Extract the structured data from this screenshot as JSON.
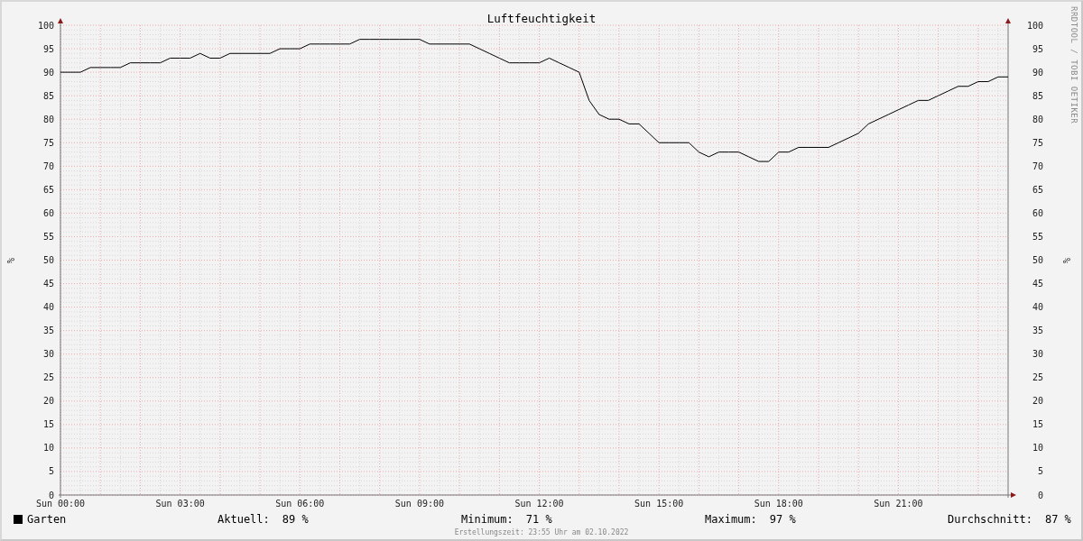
{
  "chart_data": {
    "type": "line",
    "grid": true,
    "title": "Luftfeuchtigkeit",
    "ylabel": "%",
    "ylim": [
      0,
      100
    ],
    "categories": [
      "Sun 00:00",
      null,
      null,
      null,
      null,
      null,
      null,
      null,
      null,
      null,
      null,
      null,
      "Sun 03:00",
      null,
      null,
      null,
      null,
      null,
      null,
      null,
      null,
      null,
      null,
      null,
      "Sun 06:00",
      null,
      null,
      null,
      null,
      null,
      null,
      null,
      null,
      null,
      null,
      null,
      "Sun 09:00",
      null,
      null,
      null,
      null,
      null,
      null,
      null,
      null,
      null,
      null,
      null,
      "Sun 12:00",
      null,
      null,
      null,
      null,
      null,
      null,
      null,
      null,
      null,
      null,
      null,
      "Sun 15:00",
      null,
      null,
      null,
      null,
      null,
      null,
      null,
      null,
      null,
      null,
      null,
      "Sun 18:00",
      null,
      null,
      null,
      null,
      null,
      null,
      null,
      null,
      null,
      null,
      null,
      "Sun 21:00",
      null,
      null,
      null,
      null,
      null,
      null,
      null,
      null,
      null,
      null,
      null
    ],
    "yticks": [
      0,
      5,
      10,
      15,
      20,
      25,
      30,
      35,
      40,
      45,
      50,
      55,
      60,
      65,
      70,
      75,
      80,
      85,
      90,
      95,
      100
    ],
    "series": [
      {
        "name": "Garten",
        "color": "#000000",
        "values": [
          90,
          90,
          90,
          91,
          91,
          91,
          91,
          92,
          92,
          92,
          92,
          93,
          93,
          93,
          94,
          93,
          93,
          94,
          94,
          94,
          94,
          94,
          95,
          95,
          95,
          96,
          96,
          96,
          96,
          96,
          97,
          97,
          97,
          97,
          97,
          97,
          97,
          96,
          96,
          96,
          96,
          96,
          95,
          94,
          93,
          92,
          92,
          92,
          92,
          93,
          92,
          91,
          90,
          84,
          81,
          80,
          80,
          79,
          79,
          77,
          75,
          75,
          75,
          75,
          73,
          72,
          73,
          73,
          73,
          72,
          71,
          71,
          73,
          73,
          74,
          74,
          74,
          74,
          75,
          76,
          77,
          79,
          80,
          81,
          82,
          83,
          84,
          84,
          85,
          86,
          87,
          87,
          88,
          88,
          89,
          89
        ]
      }
    ]
  },
  "right_axis": {
    "label": "%",
    "ticks": [
      "100",
      "95",
      "90",
      "85",
      "80",
      "75",
      "70",
      "65",
      "60",
      "55",
      "50",
      "45",
      "40",
      "35",
      "30",
      "25",
      "20",
      "15",
      "10",
      "5",
      "0"
    ]
  },
  "credit": "RRDTOOL / TOBI OETIKER",
  "stats": [
    {
      "label": "Aktuell:",
      "value": "89 %"
    },
    {
      "label": "Minimum:",
      "value": "71 %"
    },
    {
      "label": "Maximum:",
      "value": "97 %"
    },
    {
      "label": "Durchschnitt:",
      "value": "87 %"
    }
  ],
  "footer": "Erstellungszeit: 23:55 Uhr am 02.10.2022"
}
